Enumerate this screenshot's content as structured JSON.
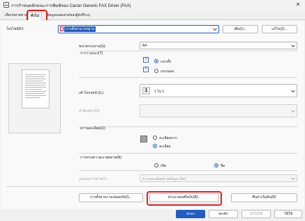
{
  "window": {
    "title": "การกำหนดลักษณะการพิมพ์ของ Canon Generic FAX Driver (FAX)",
    "close_glyph": "✕"
  },
  "tabs": [
    {
      "label": "เลือกปลายทาง"
    },
    {
      "label": "ทั่วไป"
    },
    {
      "label": "ข้อมูลแอดเดรสของผู้ส่งที่ระบุ"
    }
  ],
  "profile": {
    "label": "โปรไฟล์(F):",
    "value": "การตั้งค่ามาตรฐาน",
    "add_button": "เพิ่ม(1)...",
    "edit_button": "แก้ไข(2)..."
  },
  "page_size": {
    "label": "ขนาดกระดาษ(S):",
    "value": "A4"
  },
  "orientation": {
    "label": "การวางแนว(T)",
    "portrait": "แนวตั้ง",
    "landscape": "แนวนอน",
    "selected": "portrait"
  },
  "page_layout": {
    "label": "เค้าโครงหน้า(L):",
    "value": "1 ใน 1",
    "icon_text": "1"
  },
  "page_order": {
    "label": "ลำดับหน้า(O):"
  },
  "resolution": {
    "label": "ความละเอียด(U)",
    "fine": "ละเอียดมาก",
    "standard": "ละเอียด",
    "selected": "standard"
  },
  "watermark": {
    "label": "การทาบความเงาสดลาย(N)",
    "on": "เปิด",
    "off": "ปิด",
    "selected": "off",
    "type_label": "รูปแบบการทาบ(Y):",
    "type_value": "ความละเอียดด้านข้อมูล (ปิด)"
  },
  "buttons": {
    "cover_sheet": "การตั้งค่าความปลอดภัย(I)...",
    "restore_defaults": "ประมวลผลที่ฉบับ(B)...",
    "restore": "คืนค่าเริ่มต้น(R)",
    "ok": "ตกลง",
    "cancel": "ยกเลิก",
    "apply": "นำไปใช้",
    "help": "วิธีใช้"
  },
  "colors": {
    "accent": "#1f5cc5",
    "highlight": "#e0201e"
  }
}
